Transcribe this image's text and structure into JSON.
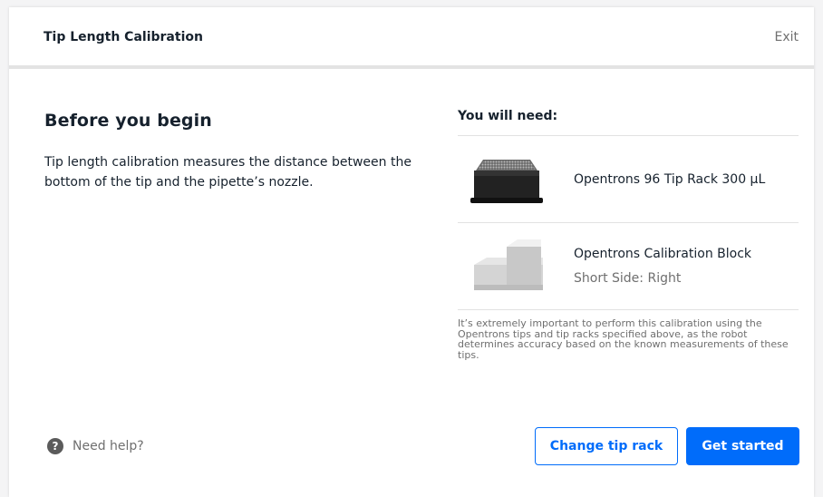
{
  "header": {
    "title": "Tip Length Calibration",
    "exit_label": "Exit"
  },
  "intro": {
    "heading": "Before you begin",
    "description": "Tip length calibration measures the distance between the bottom of the tip and the pipette’s nozzle."
  },
  "requirements": {
    "title": "You will need:",
    "items": [
      {
        "name": "Opentrons 96 Tip Rack 300 µL",
        "subtitle": "",
        "icon": "tip-rack-image"
      },
      {
        "name": "Opentrons Calibration Block",
        "subtitle": "Short Side: Right",
        "icon": "calibration-block-image"
      }
    ],
    "note": "It’s extremely important to perform this calibration using the Opentrons tips and tip racks specified above, as the robot determines accuracy based on the known measurements of these tips."
  },
  "footer": {
    "help_icon": "question-circle-icon",
    "help_label": "Need help?",
    "change_tip_rack_label": "Change tip rack",
    "get_started_label": "Get started"
  },
  "colors": {
    "accent": "#006cfa",
    "text": "#16212d",
    "muted": "#6f6f6f"
  }
}
